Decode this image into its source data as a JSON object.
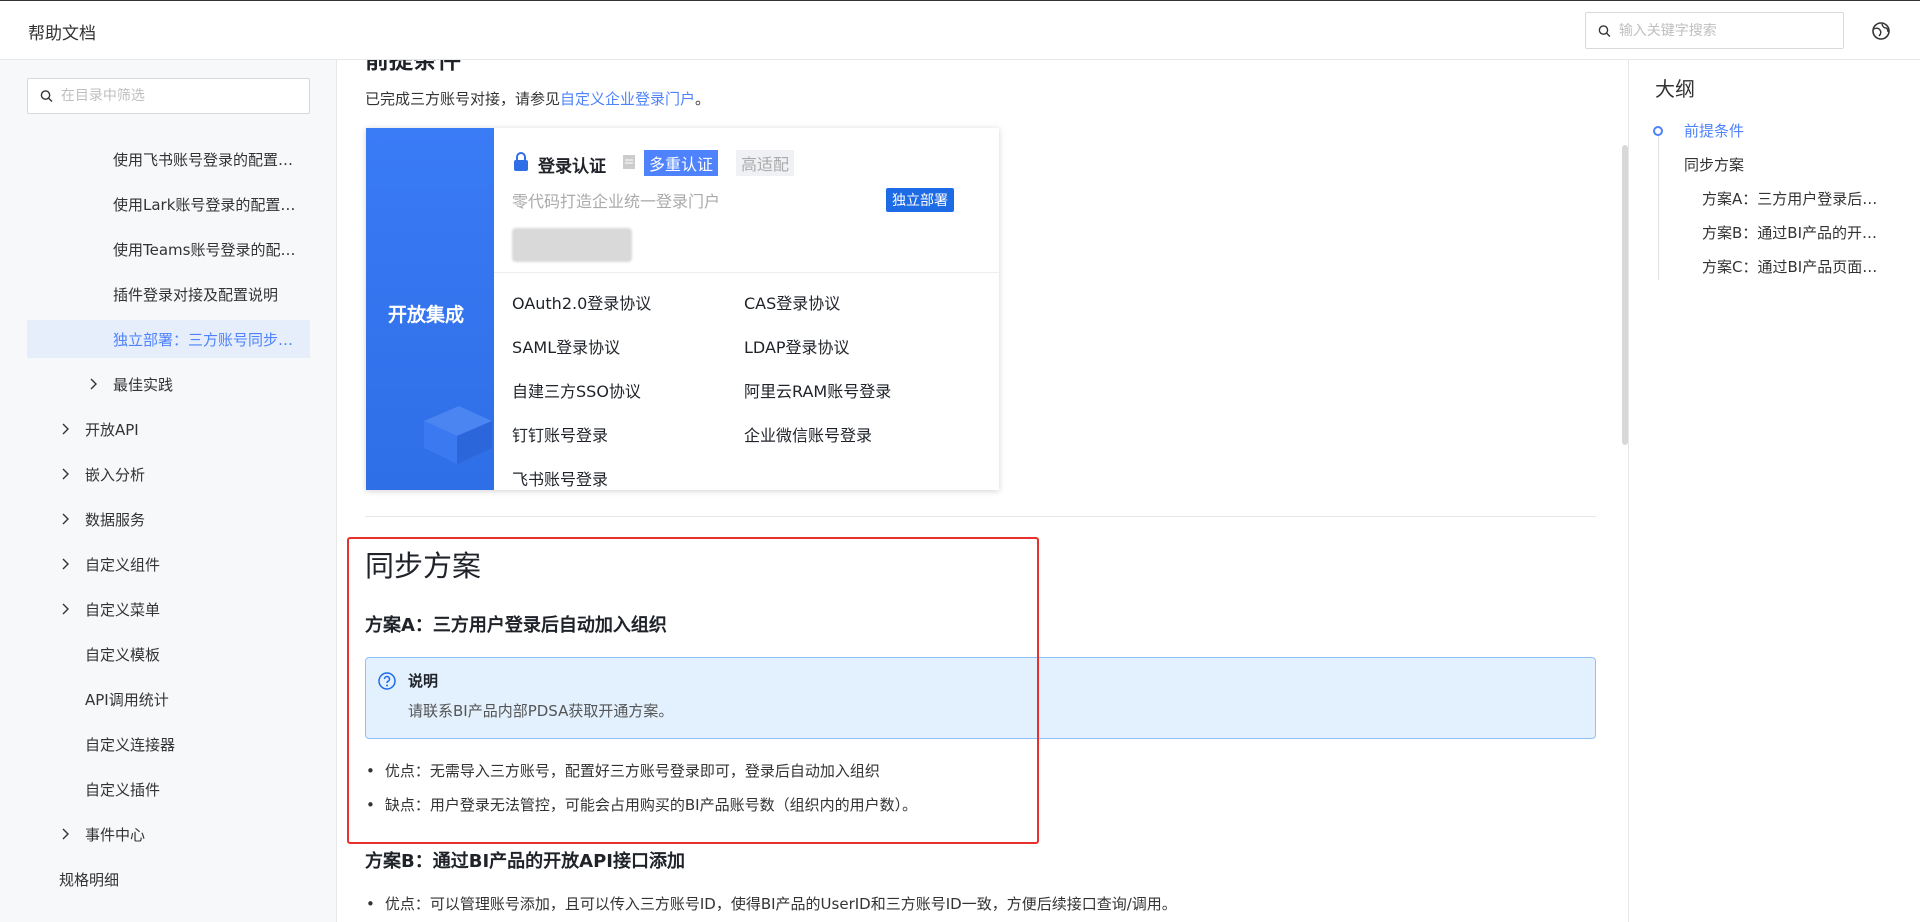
{
  "header": {
    "brand": "帮助文档",
    "search_placeholder": "输入关键字搜索",
    "globe_icon": "globe-icon"
  },
  "sidebar": {
    "filter_placeholder": "在目录中筛选",
    "items": [
      {
        "label": "使用飞书账号登录的配置…",
        "expandable": false,
        "active": false
      },
      {
        "label": "使用Lark账号登录的配置…",
        "expandable": false,
        "active": false
      },
      {
        "label": "使用Teams账号登录的配…",
        "expandable": false,
        "active": false
      },
      {
        "label": "插件登录对接及配置说明",
        "expandable": false,
        "active": false
      },
      {
        "label": "独立部署：三方账号同步…",
        "expandable": false,
        "active": true
      },
      {
        "label": "最佳实践",
        "expandable": true,
        "active": false
      },
      {
        "label": "开放API",
        "expandable": true,
        "active": false
      },
      {
        "label": "嵌入分析",
        "expandable": true,
        "active": false
      },
      {
        "label": "数据服务",
        "expandable": true,
        "active": false
      },
      {
        "label": "自定义组件",
        "expandable": true,
        "active": false
      },
      {
        "label": "自定义菜单",
        "expandable": true,
        "active": false
      },
      {
        "label": "自定义模板",
        "expandable": false,
        "active": false
      },
      {
        "label": "API调用统计",
        "expandable": false,
        "active": false
      },
      {
        "label": "自定义连接器",
        "expandable": false,
        "active": false
      },
      {
        "label": "自定义插件",
        "expandable": false,
        "active": false
      },
      {
        "label": "事件中心",
        "expandable": true,
        "active": false
      },
      {
        "label": "规格明细",
        "expandable": false,
        "active": false
      }
    ]
  },
  "content": {
    "prereq_heading": "前提条件",
    "prereq_text_before": "已完成三方账号对接，请参见",
    "prereq_link": "自定义企业登录门户",
    "prereq_text_after": "。",
    "card": {
      "left_title": "开放集成",
      "title": "登录认证",
      "tag_primary": "多重认证",
      "tag_secondary": "高适配",
      "subtitle": "零代码打造企业统一登录门户",
      "badge": "独立部署",
      "protocols": [
        "OAuth2.0登录协议",
        "CAS登录协议",
        "SAML登录协议",
        "LDAP登录协议",
        "自建三方SSO协议",
        "阿里云RAM账号登录",
        "钉钉账号登录",
        "企业微信账号登录",
        "飞书账号登录"
      ]
    },
    "sync_heading": "同步方案",
    "planA": {
      "title": "方案A：三方用户登录后自动加入组织",
      "note_title": "说明",
      "note_body": "请联系BI产品内部PDSA获取开通方案。",
      "pro": "优点：无需导入三方账号，配置好三方账号登录即可，登录后自动加入组织",
      "con": "缺点：用户登录无法管控，可能会占用购买的BI产品账号数（组织内的用户数）。"
    },
    "planB": {
      "title": "方案B：通过BI产品的开放API接口添加",
      "pro": "优点：可以管理账号添加，且可以传入三方账号ID，使得BI产品的UserID和三方账号ID一致，方便后续接口查询/调用。"
    }
  },
  "outline": {
    "title": "大纲",
    "items": [
      {
        "label": "前提条件",
        "active": true
      },
      {
        "label": "同步方案",
        "active": false
      },
      {
        "label": "方案A：三方用户登录后…",
        "active": false
      },
      {
        "label": "方案B：通过BI产品的开…",
        "active": false
      },
      {
        "label": "方案C：通过BI产品页面…",
        "active": false
      }
    ]
  },
  "colors": {
    "accent": "#4e83fd",
    "highlight_border": "#e8302c",
    "note_bg": "#e3f0fd"
  }
}
